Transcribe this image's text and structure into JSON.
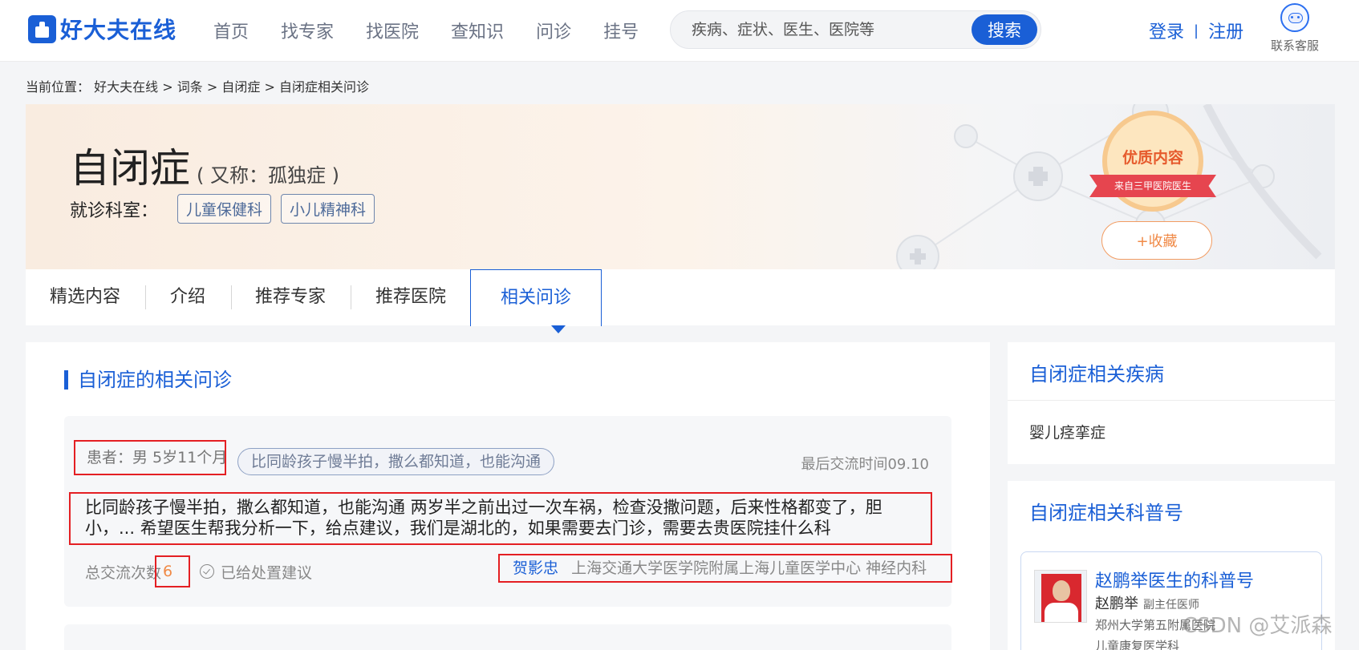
{
  "header": {
    "logo_text": "好大夫在线",
    "nav": [
      "首页",
      "找专家",
      "找医院",
      "查知识",
      "问诊",
      "挂号"
    ],
    "search_placeholder": "疾病、症状、医生、医院等",
    "search_button": "搜索",
    "login": "登录",
    "auth_separator": "|",
    "register": "注册",
    "service_label": "联系客服"
  },
  "breadcrumb": {
    "prefix": "当前位置：",
    "items": [
      "好大夫在线",
      "词条",
      "自闭症",
      "自闭症相关问诊"
    ],
    "separator": ">"
  },
  "banner": {
    "title": "自闭症",
    "alias": "( 又称：孤独症 )",
    "dept_label": "就诊科室：",
    "depts": [
      "儿童保健科",
      "小儿精神科"
    ],
    "badge_main": "优质内容",
    "badge_ribbon": "来自三甲医院医生",
    "favorite": "+收藏"
  },
  "tabs": [
    "精选内容",
    "介绍",
    "推荐专家",
    "推荐医院",
    "相关问诊"
  ],
  "active_tab": "相关问诊",
  "main": {
    "section_title": "自闭症的相关问诊",
    "consult": {
      "patient": "患者：男 5岁11个月",
      "tag": "比同龄孩子慢半拍，撒么都知道，也能沟通",
      "last_time": "最后交流时间09.10",
      "body": "比同龄孩子慢半拍，撒么都知道，也能沟通 两岁半之前出过一次车祸，检查没撒问题，后来性格都变了，胆小，... 希望医生帮我分析一下，给点建议，我们是湖北的，如果需要去门诊，需要去贵医院挂什么科",
      "count_label": "总交流次数",
      "count": "6",
      "status": "已给处置建议",
      "doctor": "贺影忠",
      "hospital": "上海交通大学医学院附属上海儿童医学中心",
      "dept": "神经内科"
    }
  },
  "side": {
    "related_title": "自闭症相关疾病",
    "related_items": [
      "婴儿痉挛症"
    ],
    "popsci_title": "自闭症相关科普号",
    "popsci_card": {
      "title": "赵鹏举医生的科普号",
      "name": "赵鹏举",
      "rank": "副主任医师",
      "hospital": "郑州大学第五附属医院",
      "dept": "儿童康复医学科"
    }
  },
  "watermark": "CSDN @艾派森",
  "colors": {
    "brand_blue": "#1a5fd6",
    "highlight_red": "#e41f23",
    "accent_orange": "#f08a47"
  }
}
